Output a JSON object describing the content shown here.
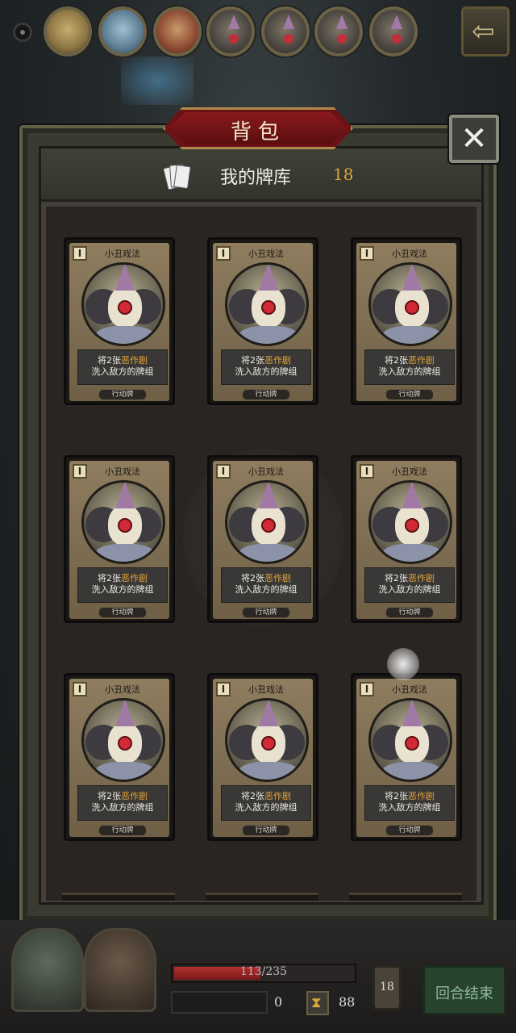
{
  "title": "背包",
  "deck": {
    "label": "我的牌库",
    "count": "18"
  },
  "close_label": "✕",
  "cards": [
    {
      "name": "小丑戏法",
      "cost": "I",
      "desc_pre": "将2张",
      "desc_hl": "恶作剧",
      "desc_line2": "洗入敌方的牌组",
      "type": "行动牌"
    },
    {
      "name": "小丑戏法",
      "cost": "I",
      "desc_pre": "将2张",
      "desc_hl": "恶作剧",
      "desc_line2": "洗入敌方的牌组",
      "type": "行动牌"
    },
    {
      "name": "小丑戏法",
      "cost": "I",
      "desc_pre": "将2张",
      "desc_hl": "恶作剧",
      "desc_line2": "洗入敌方的牌组",
      "type": "行动牌"
    },
    {
      "name": "小丑戏法",
      "cost": "I",
      "desc_pre": "将2张",
      "desc_hl": "恶作剧",
      "desc_line2": "洗入敌方的牌组",
      "type": "行动牌"
    },
    {
      "name": "小丑戏法",
      "cost": "I",
      "desc_pre": "将2张",
      "desc_hl": "恶作剧",
      "desc_line2": "洗入敌方的牌组",
      "type": "行动牌"
    },
    {
      "name": "小丑戏法",
      "cost": "I",
      "desc_pre": "将2张",
      "desc_hl": "恶作剧",
      "desc_line2": "洗入敌方的牌组",
      "type": "行动牌"
    },
    {
      "name": "小丑戏法",
      "cost": "I",
      "desc_pre": "将2张",
      "desc_hl": "恶作剧",
      "desc_line2": "洗入敌方的牌组",
      "type": "行动牌"
    },
    {
      "name": "小丑戏法",
      "cost": "I",
      "desc_pre": "将2张",
      "desc_hl": "恶作剧",
      "desc_line2": "洗入敌方的牌组",
      "type": "行动牌"
    },
    {
      "name": "小丑戏法",
      "cost": "I",
      "desc_pre": "将2张",
      "desc_hl": "恶作剧",
      "desc_line2": "洗入敌方的牌组",
      "type": "行动牌"
    }
  ],
  "hud": {
    "hp_text": "113/235",
    "hp_fraction": 0.48,
    "block": "0",
    "time": "88",
    "pile_count": "18",
    "end_turn": "回合结束"
  },
  "colors": {
    "highlight": "#e3a338",
    "count": "#d9a63a",
    "banner": "#6a1215"
  },
  "icons": {
    "close": "close-icon",
    "deck": "cards-icon",
    "hourglass": "hourglass-icon",
    "back": "back-arrow-icon"
  }
}
